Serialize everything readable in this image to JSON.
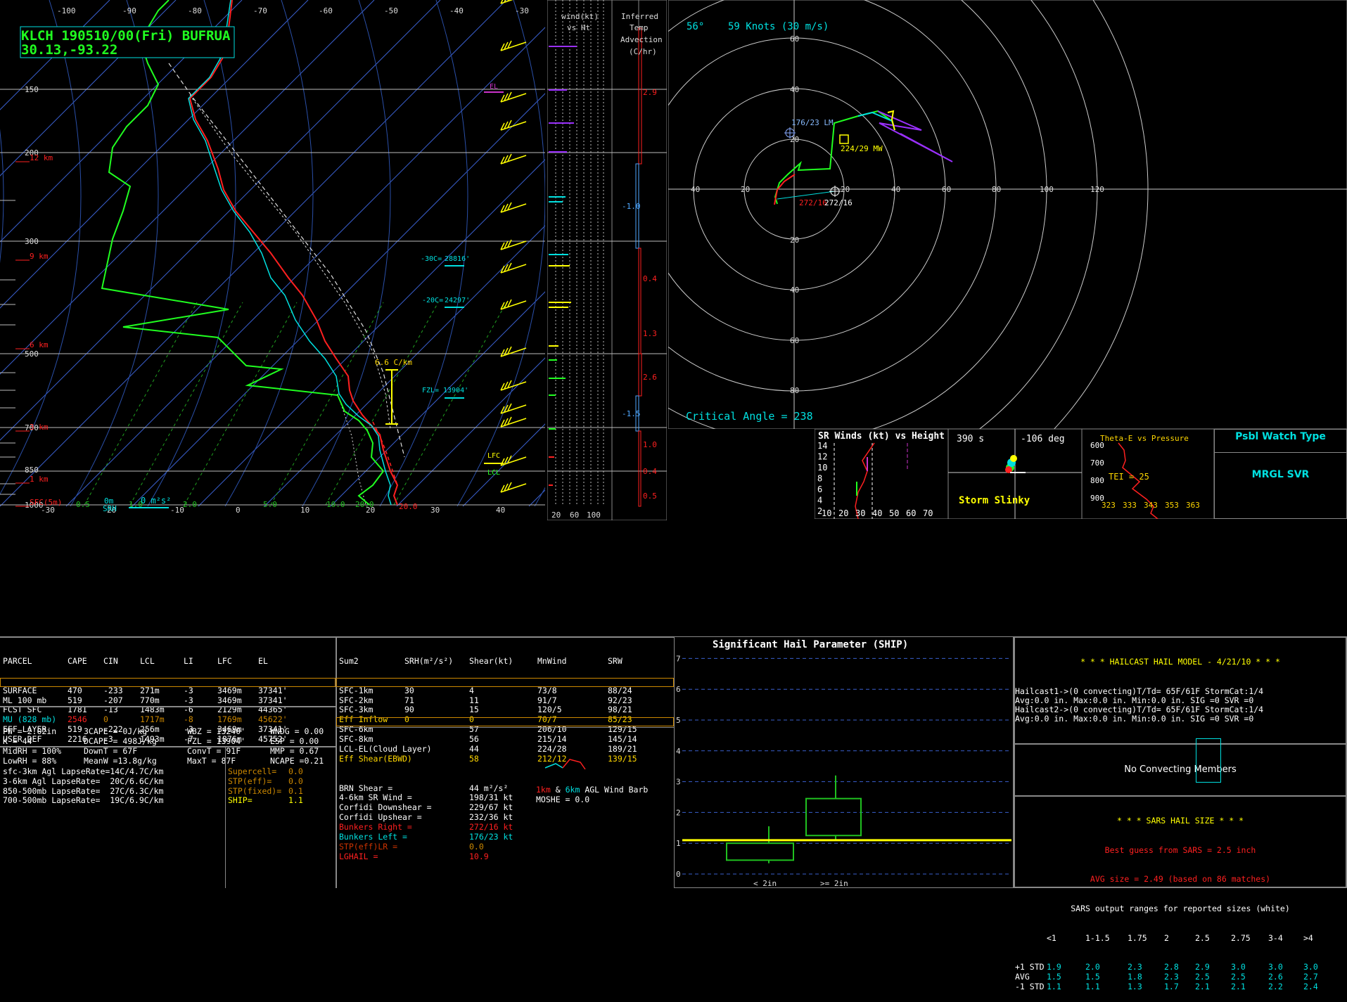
{
  "colors": {
    "green": "#00ff00",
    "cyan": "#00e0e0",
    "red": "#ff2020",
    "yellow": "#ffff00",
    "white": "#ffffff",
    "purple": "#9b30ff",
    "orange": "#ff8c00",
    "blue": "#4169e1",
    "grid": "#ffffff"
  },
  "skewt": {
    "title_line1": "KLCH 190510/00(Fri) BUFRUA",
    "title_line2": "30.13,-93.22",
    "temp_ticks_top": [
      "-100",
      "-90",
      "-80",
      "-70",
      "-60",
      "-50",
      "-40",
      "-30"
    ],
    "temp_ticks_bottom": [
      "-30",
      "20",
      "-10",
      "0",
      "10",
      "20",
      "30",
      "40"
    ],
    "pressure_labels": [
      "150",
      "200",
      "300",
      "500",
      "700",
      "850",
      "1000"
    ],
    "height_labels": [
      "12 km",
      "9 km",
      "6 km",
      "3 km",
      "1 km",
      "SFC(5m)"
    ],
    "el_label": "EL",
    "lfc_label": "LFC",
    "lcl_label": "LCL",
    "lapse_label": "6.6 C/km",
    "m30c_label": "-30C=",
    "m30c_value": "28816'",
    "m20c_label": "-20C=",
    "m20c_value": "24297'",
    "fzl_label": "FZL=",
    "fzl_value": "13904'",
    "mix_labels": [
      "0.5",
      "1.0",
      "2.0",
      "5.0",
      "10.0",
      "20.0"
    ],
    "srh_left": "0m",
    "srh_left2": "SRH",
    "srh_value": "0 m²s²",
    "bottom_value": "20.0"
  },
  "wind_panel": {
    "title1": "wind(kt)",
    "title2": "vs Ht",
    "x_labels": [
      "20",
      "60",
      "100"
    ]
  },
  "advection": {
    "title": [
      "Inferred",
      "Temp",
      "Advection",
      "(C/hr)"
    ],
    "values": [
      "2.9",
      "-1.0",
      "0.4",
      "1.3",
      "2.6",
      "-1.5",
      "1.0",
      "0.4",
      "0.5"
    ]
  },
  "hodograph": {
    "header_dir": "56°",
    "header_speed": "59 Knots (30 m/s)",
    "critical_angle": "Critical Angle = 238",
    "lm_label": "176/23 LM",
    "mw_label": "224/29 MW",
    "rm_label_a": "272/16",
    "rm_label_b": "272/16",
    "ring_labels_h": [
      "40",
      "20",
      "20",
      "40",
      "60",
      "80",
      "100",
      "120"
    ],
    "ring_labels_v": [
      "60",
      "40",
      "20",
      "20",
      "40",
      "60",
      "80"
    ]
  },
  "sr_winds": {
    "title": "SR Winds (kt) vs Height",
    "y_labels": [
      "14",
      "12",
      "10",
      "8",
      "6",
      "4",
      "2"
    ],
    "x_labels": [
      "10",
      "20",
      "30",
      "40",
      "50",
      "60",
      "70"
    ]
  },
  "storm_slinky": {
    "time": "390 s",
    "deg": "-106 deg",
    "label": "Storm Slinky"
  },
  "theta_e": {
    "title": "Theta-E vs Pressure",
    "y_labels": [
      "600",
      "700",
      "800",
      "900"
    ],
    "x_labels": [
      "323",
      "333",
      "343",
      "353",
      "363"
    ],
    "tei": "TEI = 25"
  },
  "watch": {
    "title": "Psbl Watch Type",
    "value": "MRGL SVR"
  },
  "parcel_table": {
    "headers": [
      "PARCEL",
      "CAPE",
      "CIN",
      "LCL",
      "LI",
      "LFC",
      "EL"
    ],
    "rows": [
      [
        "SURFACE",
        "470",
        "-233",
        "271m",
        "-3",
        "3469m",
        "37341'"
      ],
      [
        "ML 100 mb",
        "519",
        "-207",
        "770m",
        "-3",
        "3469m",
        "37341'"
      ],
      [
        "FCST SFC",
        "1781",
        "-13",
        "1483m",
        "-6",
        "2129m",
        "44365'"
      ],
      [
        "MU (828 mb)",
        "2546",
        "0",
        "1717m",
        "-8",
        "1769m",
        "45622'"
      ],
      [
        "EFF LAYER",
        "519",
        "-222",
        "256m",
        "-3",
        "3469m",
        "37341'"
      ],
      [
        "USER DEF",
        "2216",
        "-3",
        "1493m",
        "-7",
        "1876m",
        "45752'"
      ]
    ]
  },
  "thermo": {
    "col1": [
      "PW = 2.02in",
      "K = 44",
      "MidRH = 100%",
      "LowRH = 88%"
    ],
    "col2": [
      "3CAPE = 0J/kg",
      "DCAPE = 498J/kg",
      "DownT = 67F",
      "MeanW =13.8g/kg"
    ],
    "col3": [
      "WBZ = 13240'",
      "FZL = 13904'",
      "ConvT = 91F",
      "MaxT = 87F"
    ],
    "col4": [
      "WNDG = 0.00",
      "ESP = 0.00",
      "MMP = 0.67",
      "NCAPE =0.21"
    ]
  },
  "lapse_rates": [
    "sfc-3km Agl LapseRate=14C/4.7C/km",
    "3-6km Agl LapseRate=  20C/6.6C/km",
    "850-500mb LapseRate=  27C/6.3C/km",
    "700-500mb LapseRate=  19C/6.9C/km"
  ],
  "severe_params": [
    {
      "label": "Supercell=",
      "value": "0.0"
    },
    {
      "label": "STP(eff)=",
      "value": "0.0"
    },
    {
      "label": "STP(fixed)=",
      "value": "0.1"
    },
    {
      "label": "SHIP=",
      "value": "1.1"
    }
  ],
  "kinematic": {
    "headers": [
      "Sum2",
      "SRH(m²/s²)",
      "Shear(kt)",
      "MnWind",
      "SRW"
    ],
    "rows": [
      [
        "SFC-1km",
        "30",
        "4",
        "73/8",
        "88/24"
      ],
      [
        "SFC-2km",
        "71",
        "11",
        "91/7",
        "92/23"
      ],
      [
        "SFC-3km",
        "90",
        "15",
        "120/5",
        "98/21"
      ],
      [
        "Eff Inflow",
        "0",
        "0",
        "70/7",
        "85/23"
      ],
      [
        "SFC-6km",
        "",
        "57",
        "206/10",
        "129/15"
      ],
      [
        "SFC-8km",
        "",
        "56",
        "215/14",
        "145/14"
      ],
      [
        "LCL-EL(Cloud Layer)",
        "",
        "44",
        "224/28",
        "189/21"
      ],
      [
        "Eff Shear(EBWD)",
        "",
        "58",
        "212/12",
        "139/15"
      ]
    ],
    "lines": [
      {
        "label": "BRN Shear =",
        "value": "44 m²/s²"
      },
      {
        "label": "4-6km SR Wind =",
        "value": "198/31 kt"
      },
      {
        "label": "Corfidi Downshear =",
        "value": "229/67 kt"
      },
      {
        "label": "Corfidi Upshear =",
        "value": "232/36 kt"
      },
      {
        "label": "Bunkers Right =",
        "value": "272/16 kt"
      },
      {
        "label": "Bunkers Left =",
        "value": "176/23 kt"
      },
      {
        "label": "STP(eff)LR =",
        "value": "0.0"
      },
      {
        "label": "LGHAIL =",
        "value": "10.9"
      }
    ],
    "barb_legend_1km": "1km",
    "barb_legend_amp": "&",
    "barb_legend_6km": "6km",
    "barb_legend_rest": "AGL Wind Barb",
    "moshe": "MOSHE = 0.0"
  },
  "ship": {
    "title": "Significant Hail Parameter (SHIP)",
    "y_labels": [
      "7",
      "6",
      "5",
      "4",
      "3",
      "2",
      "1",
      "0"
    ],
    "x_labels": [
      "< 2in",
      ">= 2in"
    ],
    "boxes": [
      {
        "q1": 0.45,
        "q3": 1.0,
        "min": 0.35,
        "max": 1.55
      },
      {
        "q1": 1.25,
        "q3": 2.45,
        "min": 1.1,
        "max": 3.2
      }
    ],
    "ship_value": 1.1
  },
  "hail": {
    "title": "* * * HAILCAST HAIL MODEL - 4/21/10 * * *",
    "lines": [
      "Hailcast1->(0 convecting)T/Td= 65F/61F StormCat:1/4",
      "Avg:0.0 in. Max:0.0 in. Min:0.0 in. SIG =0 SVR =0",
      "Hailcast2->(0 convecting)T/Td= 65F/61F StormCat:1/4",
      "Avg:0.0 in. Max:0.0 in. Min:0.0 in. SIG =0 SVR =0"
    ],
    "no_convect": "No Convecting Members",
    "sars_title": "* * * SARS HAIL SIZE * * *",
    "sars_best": "Best guess from SARS = 2.5 inch",
    "sars_avg": "AVG size = 2.49 (based on 86 matches)",
    "sars_ranges": "SARS output ranges for reported sizes (white)",
    "size_headers": [
      "<1",
      "1-1.5",
      "1.75",
      "2",
      "2.5",
      "2.75",
      "3-4",
      ">4"
    ],
    "size_rows": [
      {
        "label": "+1 STD",
        "values": [
          "1.9",
          "2.0",
          "2.3",
          "2.8",
          "2.9",
          "3.0",
          "3.0",
          "3.0"
        ]
      },
      {
        "label": "AVG",
        "values": [
          "1.5",
          "1.5",
          "1.8",
          "2.3",
          "2.5",
          "2.5",
          "2.6",
          "2.7"
        ]
      },
      {
        "label": "-1 STD",
        "values": [
          "1.1",
          "1.1",
          "1.3",
          "1.7",
          "2.1",
          "2.1",
          "2.2",
          "2.4"
        ]
      }
    ]
  }
}
